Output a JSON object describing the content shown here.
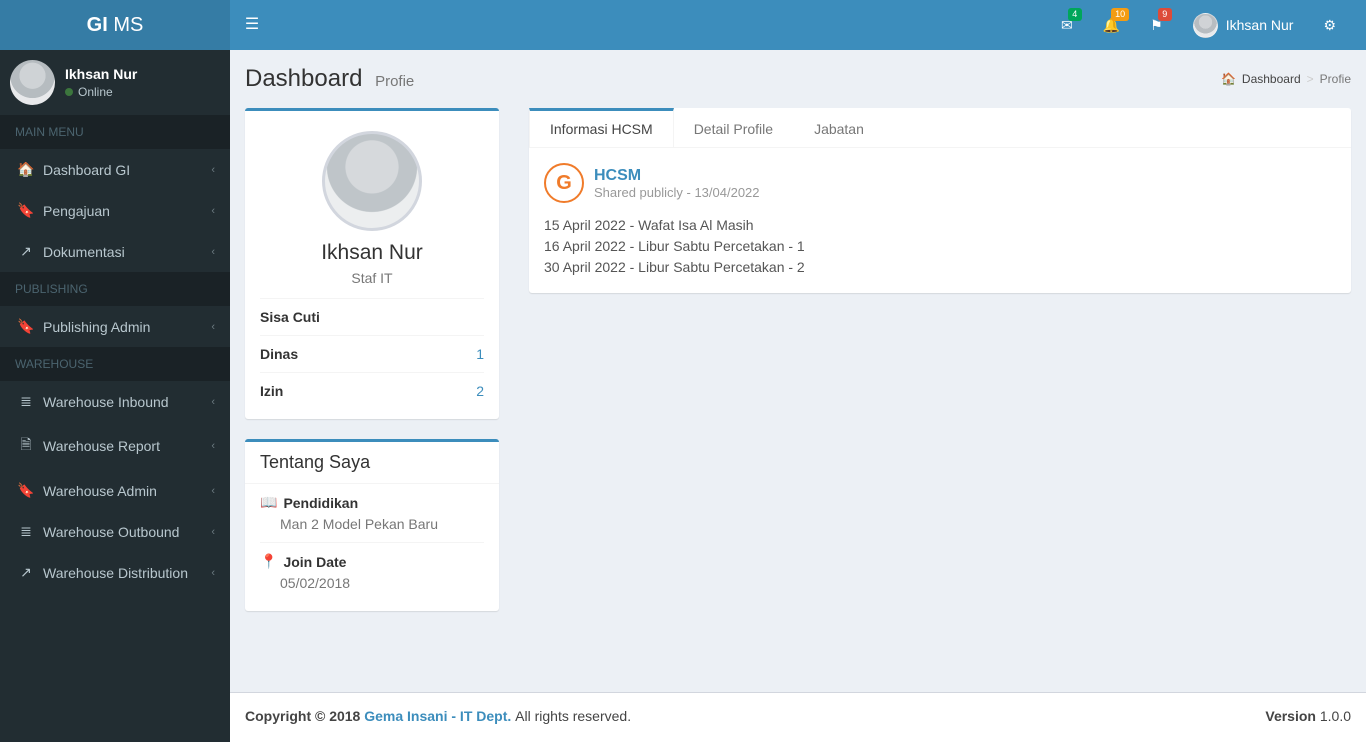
{
  "brand": {
    "bold": "GI",
    "light": " MS"
  },
  "header": {
    "mail_badge": "4",
    "bell_badge": "10",
    "flag_badge": "9",
    "user_name": "Ikhsan Nur"
  },
  "sidebar": {
    "user_name": "Ikhsan Nur",
    "user_status": "Online",
    "sections": {
      "main": "MAIN MENU",
      "publishing": "PUBLISHING",
      "warehouse": "WAREHOUSE"
    },
    "items": {
      "dashboard": "Dashboard GI",
      "pengajuan": "Pengajuan",
      "dokumentasi": "Dokumentasi",
      "publishing_admin": "Publishing Admin",
      "wh_inbound": "Warehouse Inbound",
      "wh_report": "Warehouse Report",
      "wh_admin": "Warehouse Admin",
      "wh_outbound": "Warehouse Outbound",
      "wh_distribution": "Warehouse Distribution"
    }
  },
  "page": {
    "title": "Dashboard",
    "subtitle": "Profie",
    "breadcrumb": {
      "root": "Dashboard",
      "leaf": "Profie"
    }
  },
  "profile": {
    "name": "Ikhsan Nur",
    "role": "Staf IT",
    "stats": {
      "sisa_cuti_label": "Sisa Cuti",
      "sisa_cuti_value": "",
      "dinas_label": "Dinas",
      "dinas_value": "1",
      "izin_label": "Izin",
      "izin_value": "2"
    }
  },
  "about": {
    "title": "Tentang Saya",
    "edu_label": "Pendidikan",
    "edu_value": "Man 2 Model Pekan Baru",
    "join_label": "Join Date",
    "join_value": "05/02/2018"
  },
  "tabs": {
    "hcsm": "Informasi HCSM",
    "detail": "Detail Profile",
    "jabatan": "Jabatan"
  },
  "post": {
    "logo_letter": "G",
    "title": "HCSM",
    "meta": "Shared publicly - 13/04/2022",
    "lines": [
      "15 April 2022 - Wafat Isa Al Masih",
      "16 April 2022 - Libur Sabtu Percetakan - 1",
      "30 April 2022 - Libur Sabtu Percetakan - 2"
    ]
  },
  "footer": {
    "copyright_prefix": "Copyright © 2018 ",
    "company": "Gema Insani - IT Dept.",
    "rights": " All rights reserved.",
    "version_label": "Version",
    "version_value": " 1.0.0"
  }
}
